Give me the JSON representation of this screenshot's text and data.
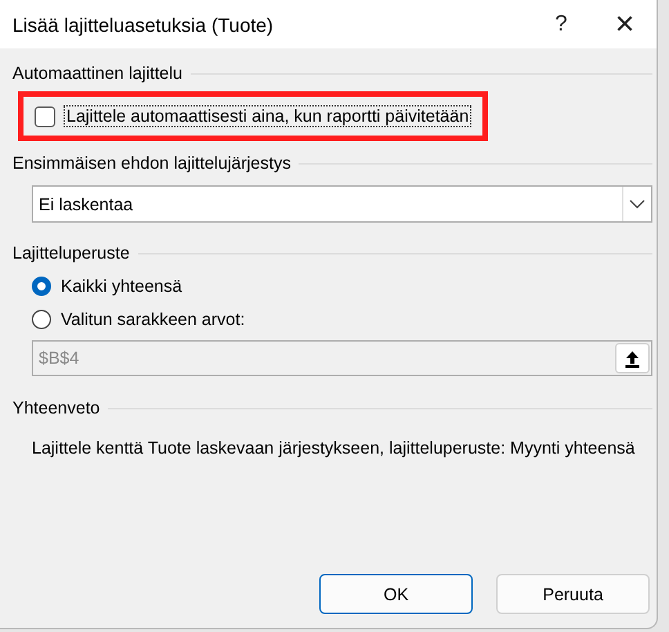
{
  "window": {
    "title": "Lisää lajitteluasetuksia (Tuote)",
    "help": "?",
    "close": "×"
  },
  "auto_sort": {
    "heading": "Automaattinen lajittelu",
    "checkbox": {
      "label": "Lajittele automaattisesti aina, kun raportti päivitetään",
      "checked": false,
      "highlighted": true
    }
  },
  "first_key_order": {
    "heading": "Ensimmäisen ehdon lajittelujärjestys",
    "value": "Ei laskentaa"
  },
  "sort_by": {
    "heading": "Lajitteluperuste",
    "options": [
      {
        "label": "Kaikki yhteensä",
        "selected": true
      },
      {
        "label": "Valitun sarakkeen arvot:",
        "selected": false
      }
    ],
    "range": {
      "value": "$B$4",
      "disabled": true
    }
  },
  "summary": {
    "heading": "Yhteenveto",
    "text": "Lajittele kenttä Tuote laskevaan järjestykseen, lajitteluperuste: Myynti yhteensä"
  },
  "buttons": [
    {
      "label": "OK",
      "default": true
    },
    {
      "label": "Peruuta",
      "default": false
    }
  ]
}
